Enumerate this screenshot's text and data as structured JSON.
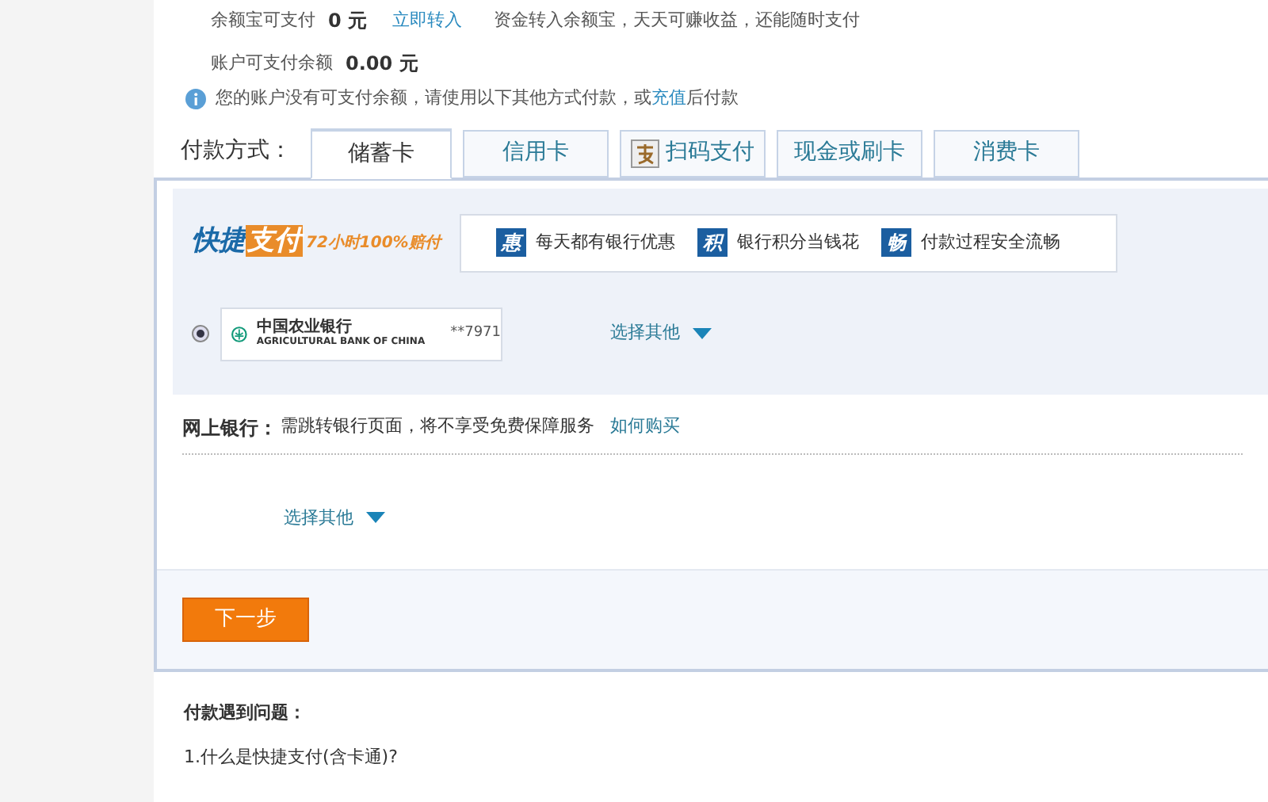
{
  "balance": {
    "yuebao_label": "余额宝可支付",
    "yuebao_amount": "0 元",
    "transfer_link": "立即转入",
    "yuebao_note": "资金转入余额宝，天天可赚收益，还能随时支付",
    "account_label": "账户可支付余额",
    "account_amount": "0.00 元"
  },
  "notice": {
    "before": "您的账户没有可支付余额，请使用以下其他方式付款，或",
    "link": "充值",
    "after": "后付款"
  },
  "payment_label": "付款方式：",
  "tabs": [
    {
      "label": "储蓄卡",
      "selected": true,
      "kind": "text"
    },
    {
      "label": "信用卡",
      "selected": false,
      "kind": "text"
    },
    {
      "label": "扫码支付",
      "selected": false,
      "kind": "scan"
    },
    {
      "label": "现金或刷卡",
      "selected": false,
      "kind": "text"
    },
    {
      "label": "消费卡",
      "selected": false,
      "kind": "text"
    }
  ],
  "quick_pay": {
    "logo_a": "快捷",
    "logo_b": "支付",
    "slogan": "72小时100%赔付",
    "features": [
      {
        "badge": "惠",
        "text": "每天都有银行优惠"
      },
      {
        "badge": "积",
        "text": "银行积分当钱花"
      },
      {
        "badge": "畅",
        "text": "付款过程安全流畅"
      }
    ],
    "card": {
      "selected": true,
      "bank_name": "中国农业银行",
      "bank_name_en": "AGRICULTURAL BANK OF CHINA",
      "number": "**7971"
    },
    "choose_other": "选择其他"
  },
  "online_bank": {
    "label": "网上银行：",
    "note": "需跳转银行页面，将不享受免费保障服务",
    "link": "如何购买",
    "choose_other": "选择其他"
  },
  "next_button": "下一步",
  "help": {
    "title": "付款遇到问题：",
    "question": "1.什么是快捷支付(含卡通)?"
  }
}
